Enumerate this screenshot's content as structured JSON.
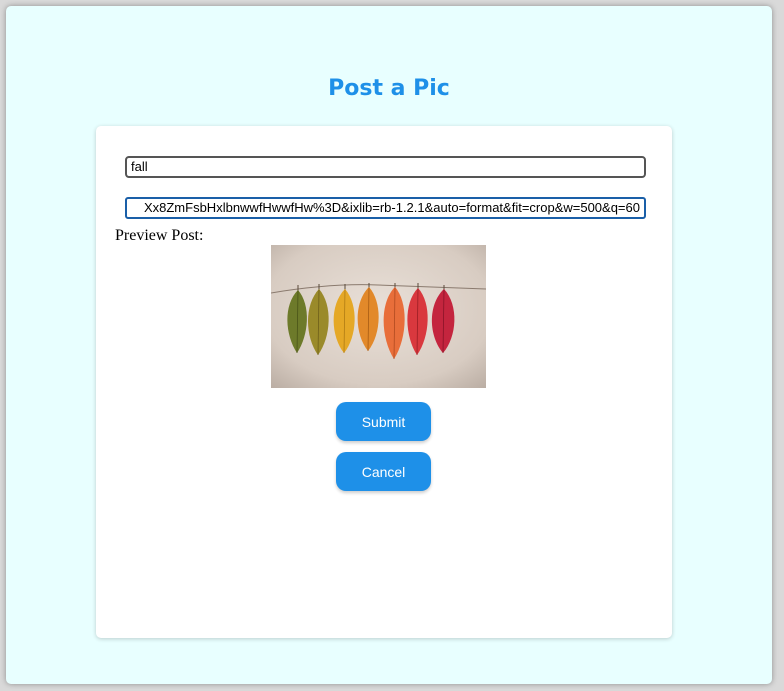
{
  "header": {
    "title": "Post a Pic"
  },
  "form": {
    "caption_value": "fall",
    "url_value": "Xx8ZmFsbHxlbnwwfHwwfHw%3D&ixlib=rb-1.2.1&auto=format&fit=crop&w=500&q=60",
    "preview_label": "Preview Post:",
    "preview_image": "leaves-on-string-photo",
    "submit_label": "Submit",
    "cancel_label": "Cancel"
  },
  "colors": {
    "background": "#e8ffff",
    "accent": "#1e90e8",
    "card": "#ffffff"
  }
}
